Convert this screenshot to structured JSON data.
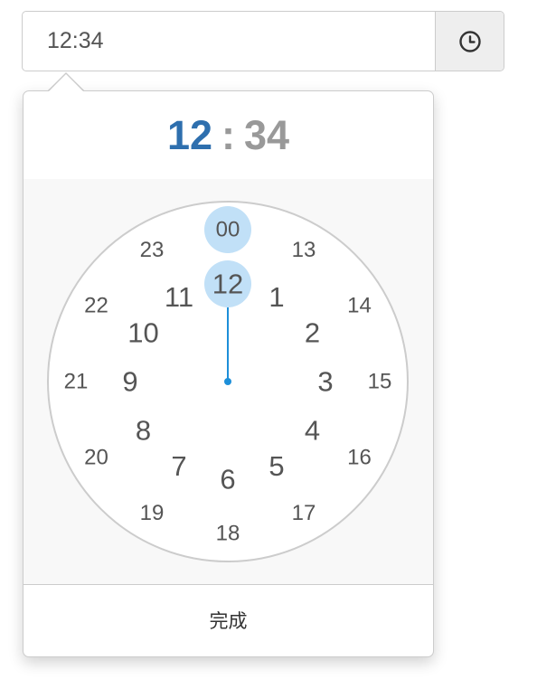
{
  "input": {
    "value": "12:34"
  },
  "header": {
    "hours": "12",
    "separator": ":",
    "minutes": "34"
  },
  "clock": {
    "selected_hour": 12,
    "outer_hours": [
      "12",
      "1",
      "2",
      "3",
      "4",
      "5",
      "6",
      "7",
      "8",
      "9",
      "10",
      "11"
    ],
    "inner_hours": [
      "00",
      "13",
      "14",
      "15",
      "16",
      "17",
      "18",
      "19",
      "20",
      "21",
      "22",
      "23"
    ],
    "highlight_color": "#c1e0f7",
    "hand_color": "#1d8fd9"
  },
  "footer": {
    "done_label": "完成"
  }
}
